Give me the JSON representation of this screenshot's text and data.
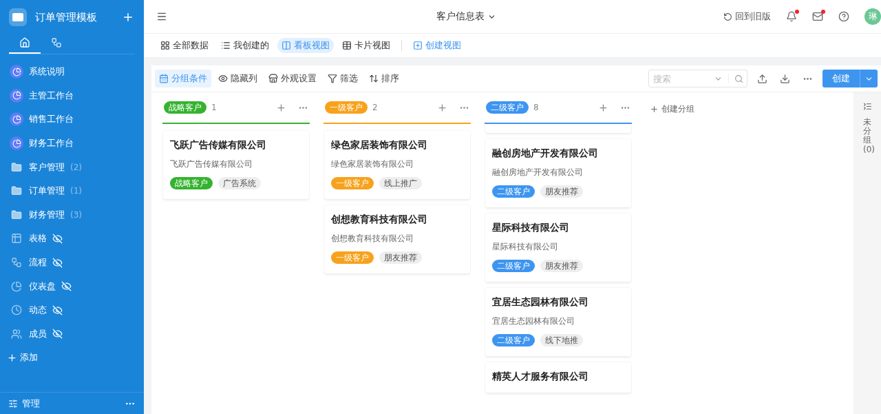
{
  "app": {
    "title": "订单管理模板"
  },
  "sidebar": {
    "tabs": [
      {
        "kind": "home",
        "selected": true
      },
      {
        "kind": "flow",
        "selected": false
      }
    ],
    "items": [
      {
        "kind": "dashboard",
        "label": "系统说明"
      },
      {
        "kind": "dashboard",
        "label": "主管工作台"
      },
      {
        "kind": "dashboard",
        "label": "销售工作台"
      },
      {
        "kind": "dashboard",
        "label": "财务工作台"
      },
      {
        "kind": "folder",
        "label": "客户管理",
        "count": "(2)"
      },
      {
        "kind": "folder",
        "label": "订单管理",
        "count": "(1)"
      },
      {
        "kind": "folder",
        "label": "财务管理",
        "count": "(3)"
      },
      {
        "kind": "table",
        "label": "表格",
        "hidden": true
      },
      {
        "kind": "flow",
        "label": "流程",
        "hidden": true
      },
      {
        "kind": "chart",
        "label": "仪表盘",
        "hidden": true
      },
      {
        "kind": "activity",
        "label": "动态",
        "hidden": true
      },
      {
        "kind": "members",
        "label": "成员",
        "hidden": true
      }
    ],
    "add": "添加",
    "footer": "管理"
  },
  "header": {
    "title": "客户信息表",
    "old_version": "回到旧版",
    "notifications_unread": true,
    "inbox_unread": true,
    "avatar": "琳"
  },
  "views": [
    {
      "kind": "grid",
      "label": "全部数据",
      "selected": false
    },
    {
      "kind": "list",
      "label": "我创建的",
      "selected": false
    },
    {
      "kind": "kanban",
      "label": "看板视图",
      "selected": true
    },
    {
      "kind": "card",
      "label": "卡片视图",
      "selected": false
    },
    {
      "kind": "create",
      "label": "创建视图",
      "selected": false
    }
  ],
  "toolbar": [
    {
      "kind": "group",
      "label": "分组条件",
      "selected": true
    },
    {
      "kind": "hide",
      "label": "隐藏列",
      "selected": false
    },
    {
      "kind": "appearance",
      "label": "外观设置",
      "selected": false
    },
    {
      "kind": "filter",
      "label": "筛选",
      "selected": false
    },
    {
      "kind": "sort",
      "label": "排序",
      "selected": false
    }
  ],
  "search": {
    "placeholder": "搜索"
  },
  "create_button": "创建",
  "columns": [
    {
      "title": "战略客户",
      "count": "1",
      "color": "#35b330",
      "scrolled": false,
      "cards": [
        {
          "title": "飞跃广告传媒有限公司",
          "subtitle": "飞跃广告传媒有限公司",
          "tags": [
            "战略客户",
            "广告系统"
          ]
        }
      ]
    },
    {
      "title": "一级客户",
      "count": "2",
      "color": "#f7a21d",
      "scrolled": false,
      "cards": [
        {
          "title": "绿色家居装饰有限公司",
          "subtitle": "绿色家居装饰有限公司",
          "tags": [
            "一级客户",
            "线上推广"
          ]
        },
        {
          "title": "创想教育科技有限公司",
          "subtitle": "创想教育科技有限公司",
          "tags": [
            "一级客户",
            "朋友推荐"
          ]
        }
      ]
    },
    {
      "title": "二级客户",
      "count": "8",
      "color": "#3d95f0",
      "scrolled": true,
      "cards": [
        {
          "title": "融创房地产开发有限公司",
          "subtitle": "融创房地产开发有限公司",
          "tags": [
            "二级客户",
            "朋友推荐"
          ]
        },
        {
          "title": "星际科技有限公司",
          "subtitle": "星际科技有限公司",
          "tags": [
            "二级客户",
            "朋友推荐"
          ]
        },
        {
          "title": "宜居生态园林有限公司",
          "subtitle": "宜居生态园林有限公司",
          "tags": [
            "二级客户",
            "线下地推"
          ]
        },
        {
          "title": "精英人才服务有限公司"
        }
      ]
    }
  ],
  "add_group": "创建分组",
  "ungrouped": "未分组 (0)"
}
